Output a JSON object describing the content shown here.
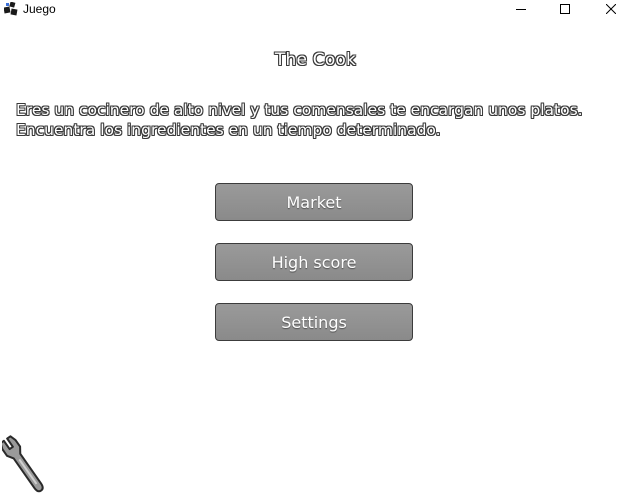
{
  "window": {
    "title": "Juego",
    "controls": [
      "minimize",
      "maximize",
      "close"
    ]
  },
  "game": {
    "title": "The Cook",
    "intro_lines": [
      "Eres un cocinero de alto nivel y tus comensales te encargan unos platos.",
      "Encuentra los ingredientes en un tiempo determinado."
    ]
  },
  "menu": {
    "market_label": "Market",
    "highscore_label": "High score",
    "settings_label": "Settings"
  },
  "icons": {
    "app": "app-logo-icon",
    "settings_tool": "wrench-icon"
  },
  "colors": {
    "button_fill": "#8f8f8f",
    "button_border": "#3c3c3c",
    "text_outline": "#3a3a3a"
  }
}
